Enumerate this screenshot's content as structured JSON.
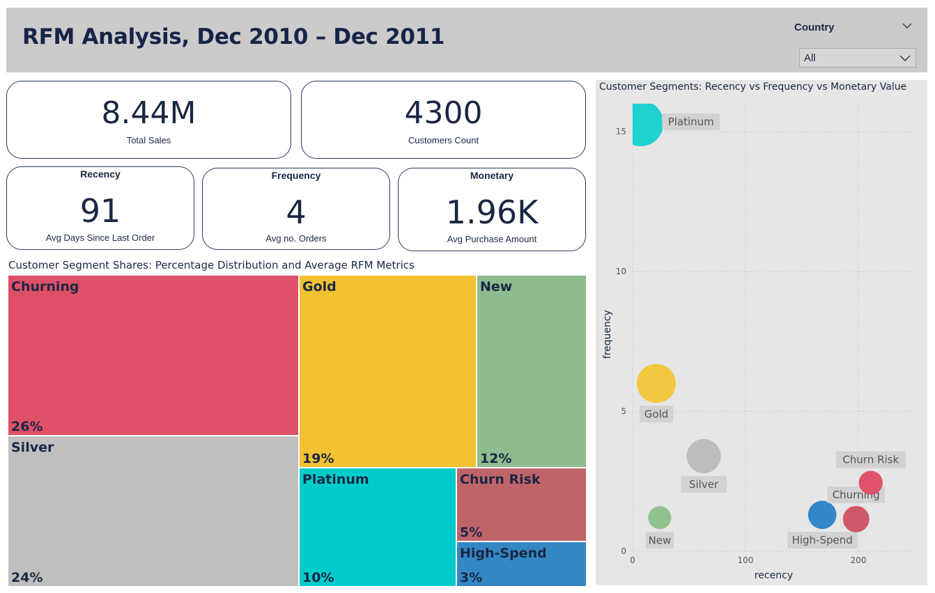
{
  "header": {
    "title": "RFM Analysis, Dec 2010 – Dec 2011",
    "slicer": {
      "label": "Country",
      "value": "All"
    }
  },
  "cards": {
    "total_sales": {
      "value": "8.44M",
      "label": "Total Sales"
    },
    "customers": {
      "value": "4300",
      "label": "Customers Count"
    },
    "recency": {
      "title": "Recency",
      "value": "91",
      "label": "Avg Days Since Last Order"
    },
    "frequency": {
      "title": "Frequency",
      "value": "4",
      "label": "Avg no. Orders"
    },
    "monetary": {
      "title": "Monetary",
      "value": "1.96K",
      "label": "Avg Purchase Amount"
    }
  },
  "chart_data": [
    {
      "type": "treemap",
      "title": "Customer Segment Shares: Percentage Distribution and Average RFM Metrics",
      "segments": [
        {
          "name": "Churning",
          "share_label": "26%",
          "value": 26,
          "color": "#e04f68"
        },
        {
          "name": "Silver",
          "share_label": "24%",
          "value": 24,
          "color": "#bfbfbf"
        },
        {
          "name": "Gold",
          "share_label": "19%",
          "value": 19,
          "color": "#f1c232"
        },
        {
          "name": "New",
          "share_label": "12%",
          "value": 12,
          "color": "#8fbc8f"
        },
        {
          "name": "Platinum",
          "share_label": "10%",
          "value": 10,
          "color": "#00cccc"
        },
        {
          "name": "Churn Risk",
          "share_label": "5%",
          "value": 5,
          "color": "#c0646a"
        },
        {
          "name": "High-Spend",
          "share_label": "3%",
          "value": 3,
          "color": "#3388c4"
        }
      ]
    },
    {
      "type": "scatter",
      "title": "Customer Segments: Recency vs Frequency vs Monetary Value",
      "xlabel": "recency",
      "ylabel": "frequency",
      "xlim": [
        0,
        250
      ],
      "ylim": [
        0,
        16
      ],
      "xticks": [
        0,
        100,
        200
      ],
      "yticks": [
        0,
        5,
        10,
        15
      ],
      "grid": true,
      "points": [
        {
          "name": "Platinum",
          "x": 7,
          "y": 15.3,
          "size": 1.0,
          "color": "#1fd2d2",
          "label_pos": "right"
        },
        {
          "name": "Gold",
          "x": 21,
          "y": 6.0,
          "size": 0.72,
          "color": "#f2c840",
          "label_pos": "below"
        },
        {
          "name": "Silver",
          "x": 63,
          "y": 3.4,
          "size": 0.55,
          "color": "#bdbdbd",
          "label_pos": "below"
        },
        {
          "name": "New",
          "x": 24,
          "y": 1.2,
          "size": 0.25,
          "color": "#8fc28f",
          "label_pos": "below"
        },
        {
          "name": "High-Spend",
          "x": 168,
          "y": 1.3,
          "size": 0.38,
          "color": "#3386c8",
          "label_pos": "below"
        },
        {
          "name": "Churning",
          "x": 198,
          "y": 1.15,
          "size": 0.33,
          "color": "#d05868",
          "label_pos": "above"
        },
        {
          "name": "Churn Risk",
          "x": 211,
          "y": 2.45,
          "size": 0.27,
          "color": "#e0526a",
          "label_pos": "above"
        }
      ]
    }
  ]
}
